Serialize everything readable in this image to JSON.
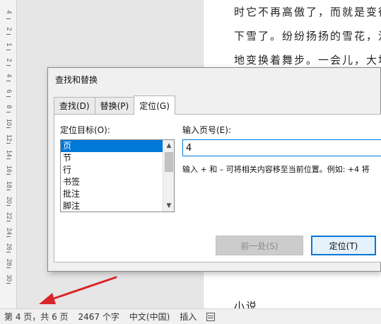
{
  "ruler": {
    "numbers": [
      "4",
      "2",
      "1",
      "2",
      "4",
      "6",
      "8",
      "10",
      "12",
      "14",
      "16",
      "18",
      "20",
      "22",
      "24",
      "26",
      "28",
      "30"
    ]
  },
  "document": {
    "lines": [
      "时它不再高傲了，而就是变得",
      "下雪了。纷纷扬扬的雪花，洁",
      "地变换着舞步。一会儿，大地"
    ],
    "bottom_text": "小说"
  },
  "dialog": {
    "title": "查找和替换",
    "tabs": [
      {
        "label": "查找(D)",
        "active": false
      },
      {
        "label": "替换(P)",
        "active": false
      },
      {
        "label": "定位(G)",
        "active": true
      }
    ],
    "goto_target_label": "定位目标(O):",
    "goto_targets": [
      "页",
      "节",
      "行",
      "书签",
      "批注",
      "脚注"
    ],
    "selected_target": "页",
    "page_number_label": "输入页号(E):",
    "page_number_value": "4",
    "hint": "输入 + 和 – 可将相关内容移至当前位置。例如: +4 将",
    "previous_button": "前一处(S)",
    "goto_button": "定位(T)"
  },
  "statusbar": {
    "page": "第 4 页，共 6 页",
    "words": "2467 个字",
    "language": "中文(中国)",
    "mode": "插入"
  },
  "colors": {
    "accent": "#0078d7",
    "arrow": "#d9262a"
  }
}
